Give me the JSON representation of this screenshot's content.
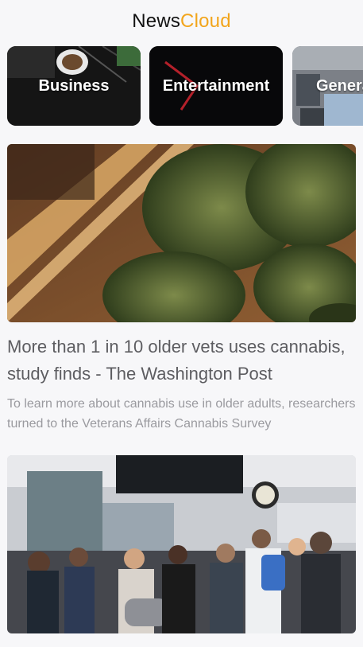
{
  "app": {
    "title_part1": "News",
    "title_part2": "Cloud",
    "accent_color": "#f2a51c"
  },
  "categories": [
    {
      "label": "Business"
    },
    {
      "label": "Entertainment"
    },
    {
      "label": "General"
    }
  ],
  "articles": [
    {
      "title": "More than 1 in 10 older vets uses cannabis, study finds - The Washington Post",
      "description": "To learn more about cannabis use in older adults, researchers turned to the Veterans Affairs Cannabis Survey",
      "image": "cannabis-buds-on-wooden-board"
    },
    {
      "title": "",
      "description": "",
      "image": "crowded-train-station-platform"
    }
  ]
}
